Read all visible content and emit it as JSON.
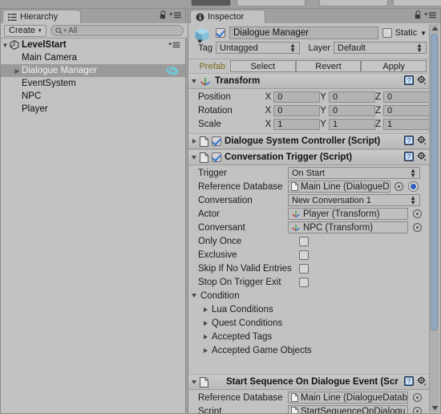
{
  "toolbar": {
    "buttons": [
      "",
      "",
      "",
      ""
    ]
  },
  "hierarchy": {
    "tab_label": "Hierarchy",
    "tab_icon": "hierarchy-icon",
    "lock_icon": "lock-icon",
    "menu_icon": "panel-menu-icon",
    "create_label": "Create",
    "create_arrow": "▾",
    "search_icon": "search-icon",
    "search_value": "All",
    "search_placeholder": "All",
    "scene": {
      "name": "LevelStart",
      "arrow": "▼",
      "icon": "unity-scene-icon",
      "menu_icon": "scene-menu-icon"
    },
    "items": [
      {
        "name": "Main Camera",
        "arrow": "",
        "selected": false,
        "badge": ""
      },
      {
        "name": "Dialogue Manager",
        "arrow": "▶",
        "selected": true,
        "badge": "dialogue-bubble-icon"
      },
      {
        "name": "EventSystem",
        "arrow": "",
        "selected": false,
        "badge": ""
      },
      {
        "name": "NPC",
        "arrow": "",
        "selected": false,
        "badge": ""
      },
      {
        "name": "Player",
        "arrow": "",
        "selected": false,
        "badge": ""
      }
    ]
  },
  "inspector": {
    "tab_label": "Inspector",
    "tab_icon": "info-icon",
    "lock_icon": "lock-icon",
    "menu_icon": "panel-menu-icon",
    "gameobject": {
      "icon": "gameobject-cube-icon",
      "enabled": true,
      "name": "Dialogue Manager",
      "static_label": "Static",
      "static_checked": false,
      "static_arrow": "▼",
      "tag_label": "Tag",
      "tag_value": "Untagged",
      "layer_label": "Layer",
      "layer_value": "Default"
    },
    "prefab": {
      "label": "Prefab",
      "select_label": "Select",
      "revert_label": "Revert",
      "apply_label": "Apply"
    },
    "components": [
      {
        "name": "transform-component",
        "title": "Transform",
        "icon": "transform-axis-icon",
        "expanded": true,
        "arrow": "▼",
        "help_icon": "help-book-icon",
        "gear_icon": "gear-icon",
        "rows": [
          {
            "label": "Position",
            "x": "0",
            "y": "0",
            "z": "0"
          },
          {
            "label": "Rotation",
            "x": "0",
            "y": "0",
            "z": "0"
          },
          {
            "label": "Scale",
            "x": "1",
            "y": "1",
            "z": "1"
          }
        ],
        "axis_labels": {
          "x": "X",
          "y": "Y",
          "z": "Z"
        }
      },
      {
        "name": "dialogue-system-controller-component",
        "title": "Dialogue System Controller (Script)",
        "icon": "script-icon",
        "expanded": false,
        "arrow": "▶",
        "enabled": true,
        "help_icon": "help-book-icon",
        "gear_icon": "gear-icon"
      },
      {
        "name": "conversation-trigger-component",
        "title": "Conversation Trigger (Script)",
        "icon": "script-icon",
        "expanded": true,
        "arrow": "▼",
        "enabled": true,
        "help_icon": "help-book-icon",
        "gear_icon": "gear-icon"
      },
      {
        "name": "start-sequence-on-dialogue-event-component",
        "title": "Start Sequence On Dialogue Event (Scri",
        "icon": "script-icon",
        "expanded": true,
        "arrow": "▼",
        "help_icon": "help-book-icon",
        "gear_icon": "gear-icon"
      }
    ],
    "conversation_trigger": {
      "trigger_label": "Trigger",
      "trigger_value": "On Start",
      "reference_database_label": "Reference Database",
      "reference_database_value": "Main Line (DialogueD",
      "reference_database_icon": "asset-icon",
      "reference_database_picker": "object-picker-icon",
      "reference_database_radio": true,
      "conversation_label": "Conversation",
      "conversation_value": "New Conversation 1",
      "actor_label": "Actor",
      "actor_value": "Player (Transform)",
      "actor_icon": "transform-axis-icon",
      "conversant_label": "Conversant",
      "conversant_value": "NPC (Transform)",
      "conversant_icon": "transform-axis-icon",
      "toggles": [
        {
          "label": "Only Once",
          "checked": false
        },
        {
          "label": "Exclusive",
          "checked": false
        },
        {
          "label": "Skip If No Valid Entries",
          "checked": false
        },
        {
          "label": "Stop On Trigger Exit",
          "checked": false
        }
      ],
      "condition_label": "Condition",
      "condition_arrow": "▼",
      "condition_children": [
        {
          "label": "Lua Conditions",
          "arrow": "▶"
        },
        {
          "label": "Quest Conditions",
          "arrow": "▶"
        },
        {
          "label": "Accepted Tags",
          "arrow": "▶"
        },
        {
          "label": "Accepted Game Objects",
          "arrow": "▶"
        }
      ]
    },
    "start_sequence": {
      "reference_database_label": "Reference Database",
      "reference_database_value": "Main Line (DialogueDatab",
      "reference_database_icon": "asset-icon",
      "reference_database_picker": "object-picker-icon",
      "script_label": "Script",
      "script_value": "StartSequenceOnDialogu",
      "script_icon": "script-icon",
      "script_picker": "object-picker-icon"
    },
    "scrollbar": {
      "name": "inspector-vertical-scrollbar"
    }
  },
  "colors": {
    "panel_bg": "#c2c2c2",
    "window_bg": "#a0a0a0",
    "selection": "#9a9a9a",
    "prefab_label": "#7a6a1e",
    "accent_blue": "#2f5fbe",
    "scroll_thumb": "#8fa8c0",
    "dialogue_icon": "#5fd8e8"
  }
}
